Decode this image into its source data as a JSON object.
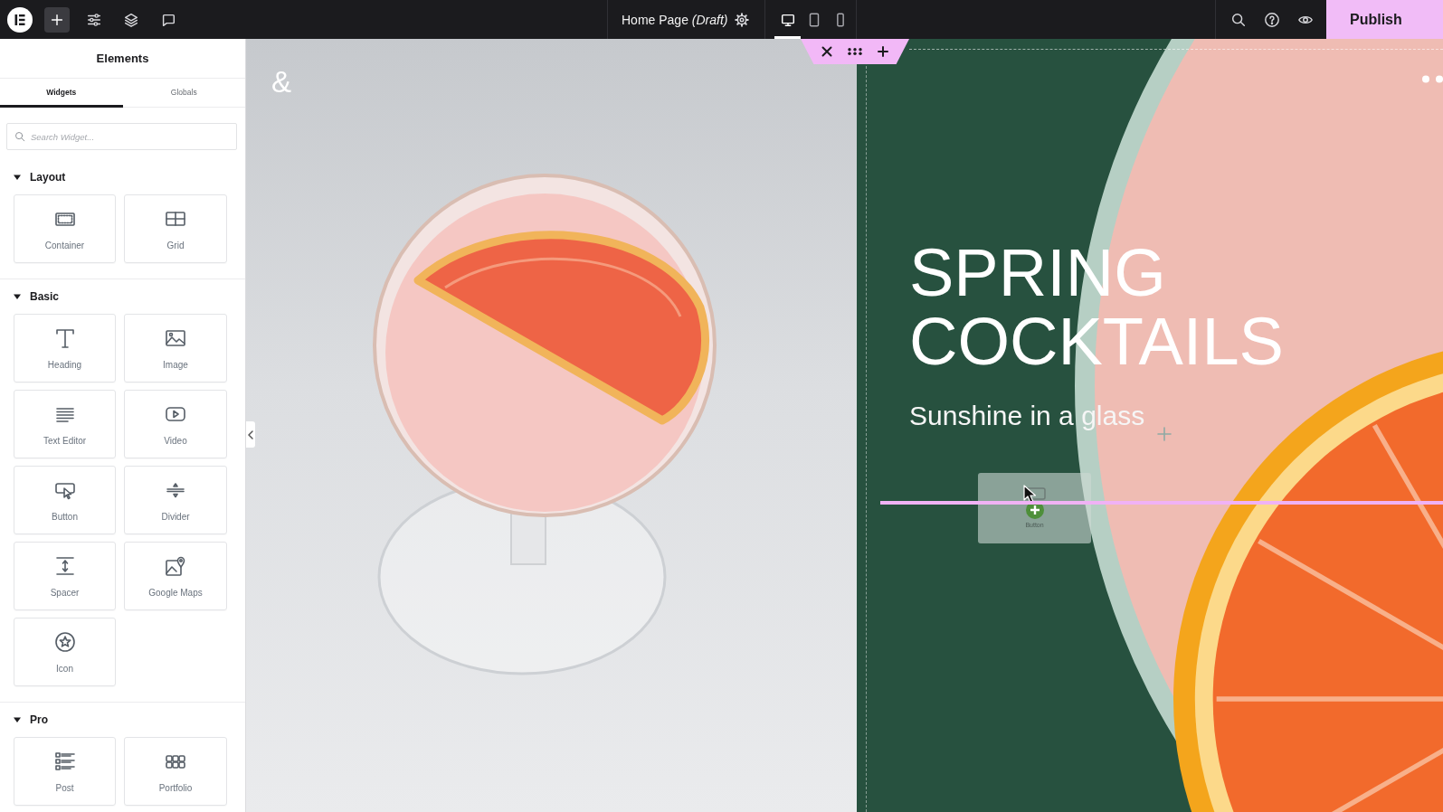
{
  "top_bar": {
    "tools": [
      {
        "kind": "add",
        "selected": true
      },
      {
        "kind": "settings",
        "selected": false
      },
      {
        "kind": "structure",
        "selected": false
      },
      {
        "kind": "notes",
        "selected": false
      }
    ],
    "page_title": "Home Page *(Draft)*",
    "devices": [
      {
        "kind": "desktop",
        "selected": true
      },
      {
        "kind": "tablet",
        "selected": false
      },
      {
        "kind": "mobile",
        "selected": false
      }
    ],
    "publish_button": "Publish"
  },
  "elements_panel": {
    "title": "Elements",
    "tabs": [
      {
        "label": "Widgets",
        "selected": true
      },
      {
        "label": "Globals",
        "selected": false
      }
    ],
    "search": {
      "placeholder": "Search Widget..."
    },
    "categories": [
      {
        "title": "Layout",
        "expanded": true,
        "widgets": [
          {
            "kind": "container",
            "label": "Container"
          },
          {
            "kind": "grid",
            "label": "Grid"
          }
        ]
      },
      {
        "title": "Basic",
        "expanded": true,
        "widgets": [
          {
            "kind": "heading",
            "label": "Heading"
          },
          {
            "kind": "image",
            "label": "Image"
          },
          {
            "kind": "text",
            "label": "Text Editor"
          },
          {
            "kind": "video",
            "label": "Video"
          },
          {
            "kind": "button",
            "label": "Button"
          },
          {
            "kind": "divider",
            "label": "Divider"
          },
          {
            "kind": "spacer",
            "label": "Spacer"
          },
          {
            "kind": "map",
            "label": "Google Maps"
          },
          {
            "kind": "icon",
            "label": "Icon"
          }
        ]
      },
      {
        "title": "Pro",
        "expanded": true,
        "widgets": [
          {
            "kind": "post",
            "label": "Post"
          },
          {
            "kind": "portfolio",
            "label": "Portfolio"
          }
        ]
      }
    ]
  },
  "canvas": {
    "logo": "&",
    "heading": "SPRING COCKTAILS",
    "subheading": "Sunshine in a glass",
    "drag_preview": {
      "label": "Button"
    }
  }
}
